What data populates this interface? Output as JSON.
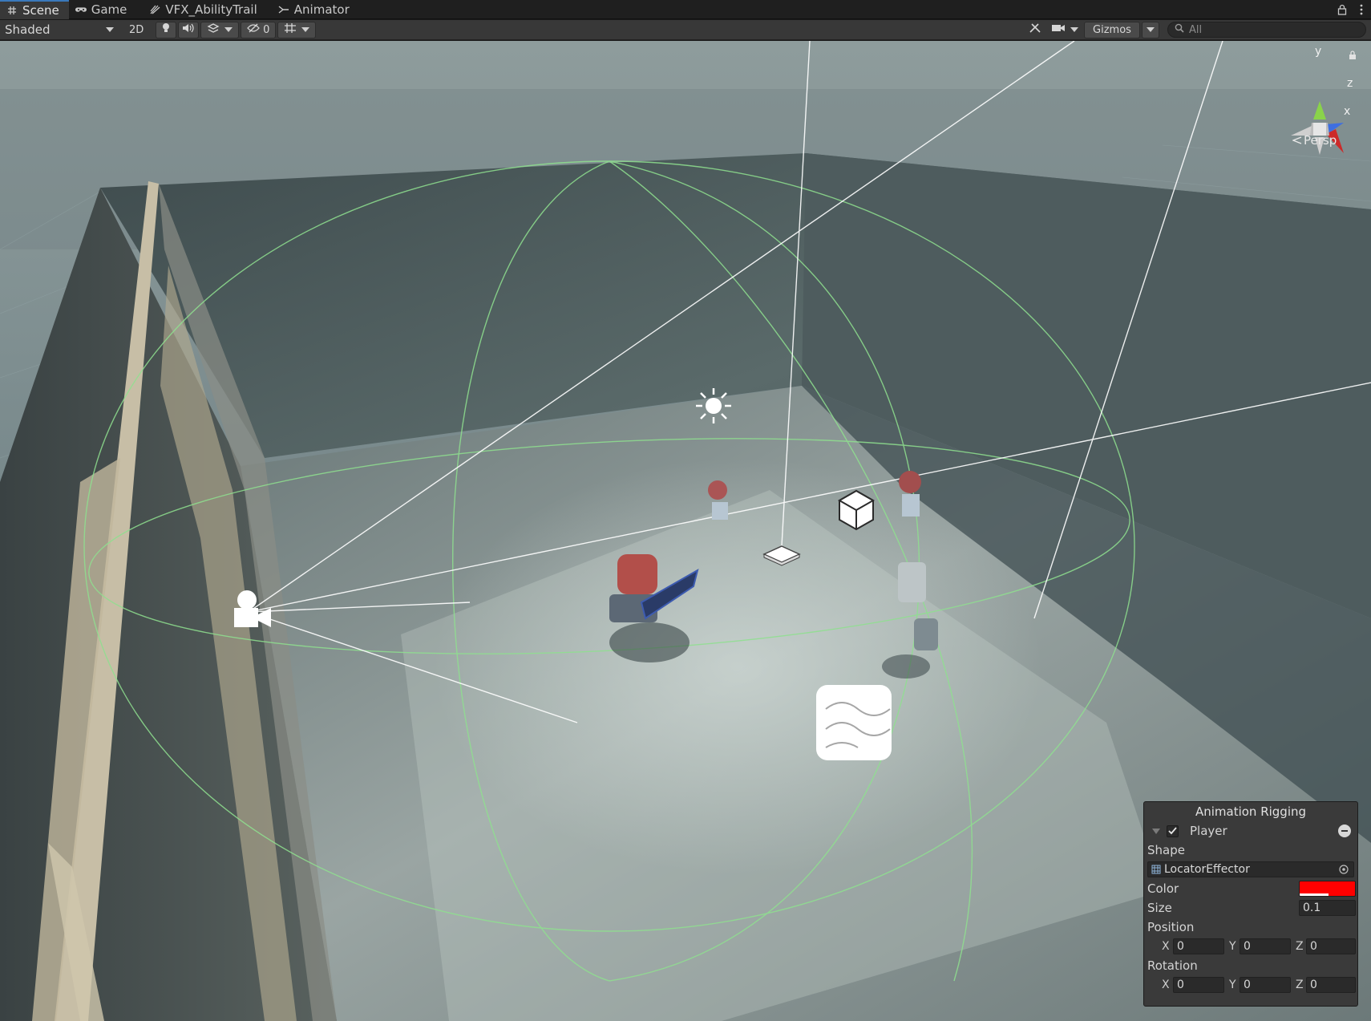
{
  "tabs": [
    {
      "label": "Scene",
      "icon": "hash-icon",
      "active": true
    },
    {
      "label": "Game",
      "icon": "gamepad-icon",
      "active": false
    },
    {
      "label": "VFX_AbilityTrail",
      "icon": "vfx-icon",
      "active": false
    },
    {
      "label": "Animator",
      "icon": "animator-icon",
      "active": false
    }
  ],
  "toolbar": {
    "shading_mode": "Shaded",
    "mode_2d": "2D",
    "hidden_count": "0",
    "gizmos_label": "Gizmos",
    "search_placeholder": "All"
  },
  "viewport": {
    "projection_label": "Persp",
    "gizmo_axes": {
      "y": "y",
      "z": "z",
      "x": "x"
    }
  },
  "overlay": {
    "title": "Animation Rigging",
    "target_name": "Player",
    "target_enabled": true,
    "shape_label": "Shape",
    "shape_value": "LocatorEffector",
    "color_label": "Color",
    "color_value": "#ff0000",
    "size_label": "Size",
    "size_value": "0.1",
    "position_label": "Position",
    "position": {
      "x": "0",
      "y": "0",
      "z": "0"
    },
    "rotation_label": "Rotation",
    "rotation": {
      "x": "0",
      "y": "0",
      "z": "0"
    },
    "axis_x": "X",
    "axis_y": "Y",
    "axis_z": "Z"
  }
}
